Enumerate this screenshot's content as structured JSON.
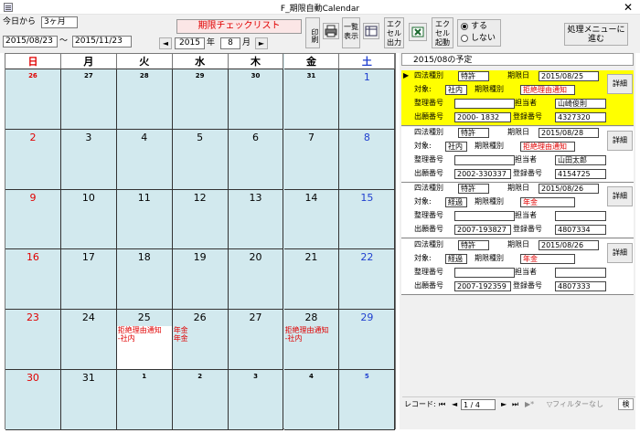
{
  "window": {
    "title": "F_期限自動Calendar",
    "close_label": "✕"
  },
  "toolbar": {
    "today_from_label": "今日から",
    "period_value": "3ヶ月",
    "date_from": "2015/08/23",
    "range_sep": "〜",
    "date_to": "2015/11/23",
    "checklist_button": "期限チェックリスト",
    "prev_label": "◄",
    "next_label": "►",
    "year_value": "2015",
    "year_unit": "年",
    "month_value": "8",
    "month_unit": "月",
    "print_label": "印刷",
    "list_view_label": "一覧表示",
    "excel_output_label": "エクセル出力",
    "excel_launch_label": "エクセル起動",
    "radio_yes": "する",
    "radio_no": "しない",
    "menu_button": "処理メニューに進む"
  },
  "calendar": {
    "weekdays": [
      "日",
      "月",
      "火",
      "水",
      "木",
      "金",
      "土"
    ],
    "weekday_colors": [
      "#e00000",
      "#000000",
      "#000000",
      "#000000",
      "#000000",
      "#000000",
      "#1f3fcf"
    ],
    "weeks": [
      [
        {
          "d": "26",
          "small": true
        },
        {
          "d": "27",
          "small": true
        },
        {
          "d": "28",
          "small": true
        },
        {
          "d": "29",
          "small": true
        },
        {
          "d": "30",
          "small": true
        },
        {
          "d": "31",
          "small": true
        },
        {
          "d": "1"
        }
      ],
      [
        {
          "d": "2"
        },
        {
          "d": "3"
        },
        {
          "d": "4"
        },
        {
          "d": "5"
        },
        {
          "d": "6"
        },
        {
          "d": "7"
        },
        {
          "d": "8"
        }
      ],
      [
        {
          "d": "9"
        },
        {
          "d": "10"
        },
        {
          "d": "11"
        },
        {
          "d": "12"
        },
        {
          "d": "13"
        },
        {
          "d": "14"
        },
        {
          "d": "15"
        }
      ],
      [
        {
          "d": "16"
        },
        {
          "d": "17"
        },
        {
          "d": "18"
        },
        {
          "d": "19"
        },
        {
          "d": "20"
        },
        {
          "d": "21"
        },
        {
          "d": "22"
        }
      ],
      [
        {
          "d": "23"
        },
        {
          "d": "24"
        },
        {
          "d": "25",
          "events": [
            "拒絶理由通知",
            "-社内"
          ],
          "white": true
        },
        {
          "d": "26",
          "events": [
            "年金",
            "年金"
          ]
        },
        {
          "d": "27"
        },
        {
          "d": "28",
          "events": [
            "拒絶理由通知",
            "-社内"
          ]
        },
        {
          "d": "29"
        }
      ],
      [
        {
          "d": "30"
        },
        {
          "d": "31"
        },
        {
          "d": "1",
          "small": true
        },
        {
          "d": "2",
          "small": true
        },
        {
          "d": "3",
          "small": true
        },
        {
          "d": "4",
          "small": true
        },
        {
          "d": "5",
          "small": true
        }
      ]
    ]
  },
  "panel": {
    "heading": "2015/08の予定",
    "labels": {
      "law_type": "四法種別",
      "deadline": "期限日",
      "target": "対象:",
      "deadline_type": "期限種別",
      "ref_no": "整理番号",
      "person": "担当者",
      "app_no": "出願番号",
      "reg_no": "登録番号",
      "detail": "詳細"
    },
    "records": [
      {
        "law": "特許",
        "date": "2015/08/25",
        "target": "社内",
        "type": "拒絶理由通知",
        "ref": "",
        "person": "山崎俊則",
        "app": "2000- 1832",
        "reg": "4327320",
        "selected": true
      },
      {
        "law": "特許",
        "date": "2015/08/28",
        "target": "社内",
        "type": "拒絶理由通知",
        "ref": "",
        "person": "山田太郎",
        "app": "2002-330337",
        "reg": "4154725",
        "selected": false
      },
      {
        "law": "特許",
        "date": "2015/08/26",
        "target": "経過",
        "type": "年金",
        "ref": "",
        "person": "",
        "app": "2007-193827",
        "reg": "4807334",
        "selected": false
      },
      {
        "law": "特許",
        "date": "2015/08/26",
        "target": "経過",
        "type": "年金",
        "ref": "",
        "person": "",
        "app": "2007-192359",
        "reg": "4807333",
        "selected": false
      }
    ],
    "record_marker": "▶"
  },
  "navbar": {
    "record_label": "レコード:",
    "first": "⏮",
    "prev": "◄",
    "position": "1 / 4",
    "next": "►",
    "last": "⏭",
    "new": "▶*",
    "filter_label": "フィルターなし",
    "search_label": "検"
  }
}
